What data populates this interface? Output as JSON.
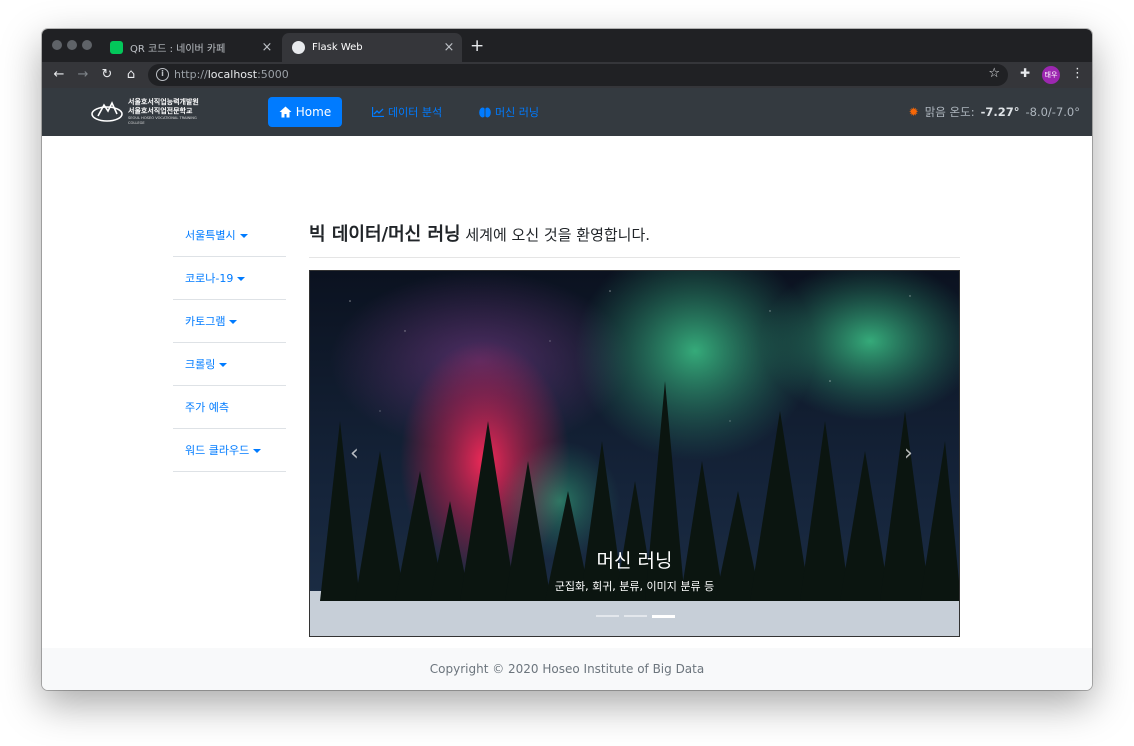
{
  "browser": {
    "tabs": [
      {
        "title": "QR 코드 : 네이버 카페",
        "favicon_color": "#03c75a"
      },
      {
        "title": "Flask Web",
        "favicon_color": "#e8eaed"
      }
    ],
    "url_prefix": "http://",
    "url_host": "localhost",
    "url_port": ":5000",
    "profile_initials": "태우"
  },
  "navbar": {
    "logo_line1": "서울호서직업능력개발원",
    "logo_line2": "서울호서직업전문학교",
    "logo_small": "SEOUL HOSEO VOCATIONAL TRAINING COLLEGE",
    "home_label": "Home",
    "data_analysis_label": "데이터 분석",
    "machine_learning_label": "머신 러닝",
    "weather_label": "맑음 온도:",
    "weather_current": "-7.27°",
    "weather_range": "-8.0/-7.0°"
  },
  "sidebar": {
    "items": [
      {
        "label": "서울특별시",
        "dropdown": true
      },
      {
        "label": "코로나-19",
        "dropdown": true
      },
      {
        "label": "카토그램",
        "dropdown": true
      },
      {
        "label": "크롤링",
        "dropdown": true
      },
      {
        "label": "주가 예측",
        "dropdown": false
      },
      {
        "label": "워드 클라우드",
        "dropdown": true
      }
    ]
  },
  "main": {
    "heading_strong": "빅 데이터/머신 러닝",
    "heading_rest": " 세계에 오신 것을 환영합니다."
  },
  "carousel": {
    "caption_title": "머신 러닝",
    "caption_text": "군집화, 회귀, 분류, 이미지 분류 등",
    "slide_count": 3,
    "active_slide": 3
  },
  "footer": {
    "copyright": "Copyright © 2020 Hoseo Institute of Big Data"
  },
  "colors": {
    "accent": "#007bff",
    "navbar_bg": "#343a40"
  }
}
